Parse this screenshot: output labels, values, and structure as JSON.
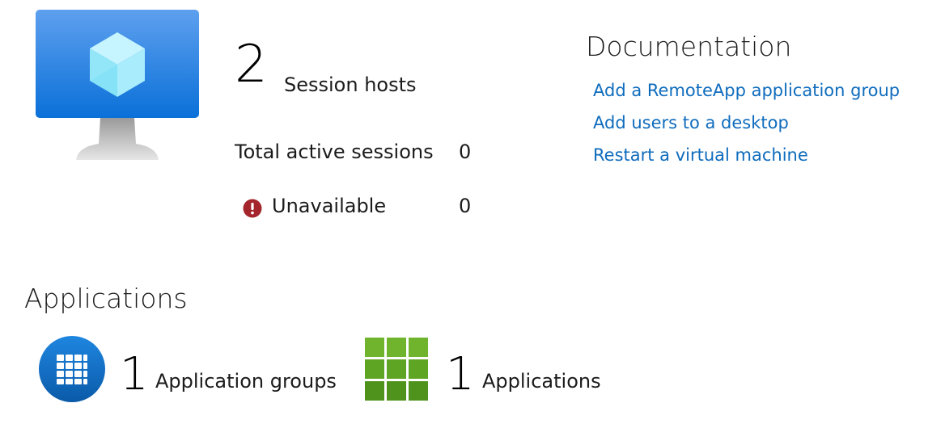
{
  "overview": {
    "hero_icon": "virtual-desktop-monitor-icon",
    "session_hosts": {
      "count": "2",
      "label": "Session hosts"
    },
    "total_active_sessions": {
      "label": "Total active sessions",
      "value": "0"
    },
    "unavailable": {
      "icon": "error-icon",
      "label": "Unavailable",
      "value": "0"
    }
  },
  "documentation": {
    "title": "Documentation",
    "links": [
      "Add a RemoteApp application group",
      "Add users to a desktop",
      "Restart a virtual machine"
    ]
  },
  "applications": {
    "title": "Applications",
    "application_groups": {
      "icon": "application-group-icon",
      "count": "1",
      "label": "Application groups"
    },
    "apps": {
      "icon": "applications-grid-icon",
      "count": "1",
      "label": "Applications"
    }
  },
  "colors": {
    "link": "#0f6cbd",
    "error": "#a4262c",
    "monitor_blue": "#2f86e0",
    "app_green": "#6fb42c",
    "app_group_blue": "#0a62b7"
  }
}
